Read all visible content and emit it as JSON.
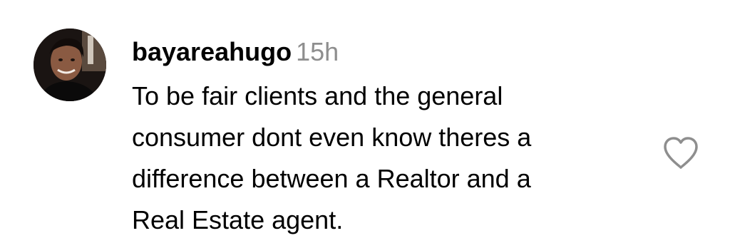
{
  "comment": {
    "username": "bayareahugo",
    "timestamp": "15h",
    "text_lines": [
      "To be fair clients and the general",
      "consumer dont even know theres a",
      "difference between a Realtor and a",
      "Real Estate agent."
    ]
  },
  "icons": {
    "like": "heart-outline-icon",
    "avatar": "user-avatar"
  },
  "colors": {
    "text": "#000000",
    "timestamp": "#8e8e8e",
    "icon_stroke": "#8e8e8e",
    "background": "#ffffff"
  }
}
